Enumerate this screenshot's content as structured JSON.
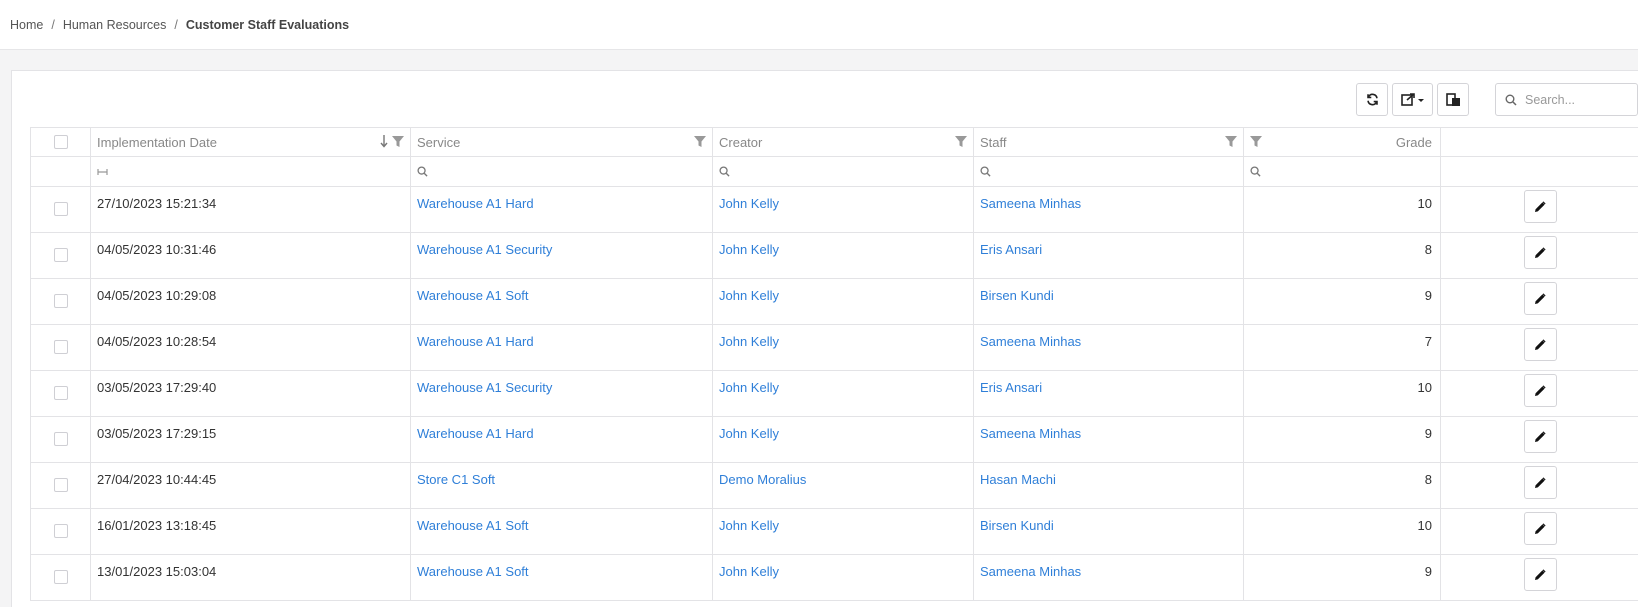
{
  "breadcrumb": {
    "home": "Home",
    "section": "Human Resources",
    "current": "Customer Staff Evaluations",
    "separator": "/"
  },
  "toolbar": {
    "refresh_icon": "refresh-icon",
    "export_icon": "export-icon",
    "columns_icon": "column-chooser-icon",
    "search_placeholder": "Search..."
  },
  "colors": {
    "link": "#2f7fd8",
    "border": "#e3e3e6",
    "header_text": "#888888"
  },
  "table": {
    "columns": [
      "Implementation Date",
      "Service",
      "Creator",
      "Staff",
      "Grade"
    ],
    "rows": [
      {
        "date": "27/10/2023 15:21:34",
        "service": "Warehouse A1 Hard",
        "creator": "John Kelly",
        "staff": "Sameena Minhas",
        "grade": "10"
      },
      {
        "date": "04/05/2023 10:31:46",
        "service": "Warehouse A1 Security",
        "creator": "John Kelly",
        "staff": "Eris Ansari",
        "grade": "8"
      },
      {
        "date": "04/05/2023 10:29:08",
        "service": "Warehouse A1 Soft",
        "creator": "John Kelly",
        "staff": "Birsen Kundi",
        "grade": "9"
      },
      {
        "date": "04/05/2023 10:28:54",
        "service": "Warehouse A1 Hard",
        "creator": "John Kelly",
        "staff": "Sameena Minhas",
        "grade": "7"
      },
      {
        "date": "03/05/2023 17:29:40",
        "service": "Warehouse A1 Security",
        "creator": "John Kelly",
        "staff": "Eris Ansari",
        "grade": "10"
      },
      {
        "date": "03/05/2023 17:29:15",
        "service": "Warehouse A1 Hard",
        "creator": "John Kelly",
        "staff": "Sameena Minhas",
        "grade": "9"
      },
      {
        "date": "27/04/2023 10:44:45",
        "service": "Store C1 Soft",
        "creator": "Demo Moralius",
        "staff": "Hasan Machi",
        "grade": "8"
      },
      {
        "date": "16/01/2023 13:18:45",
        "service": "Warehouse A1 Soft",
        "creator": "John Kelly",
        "staff": "Birsen Kundi",
        "grade": "10"
      },
      {
        "date": "13/01/2023 15:03:04",
        "service": "Warehouse A1 Soft",
        "creator": "John Kelly",
        "staff": "Sameena Minhas",
        "grade": "9"
      }
    ]
  }
}
